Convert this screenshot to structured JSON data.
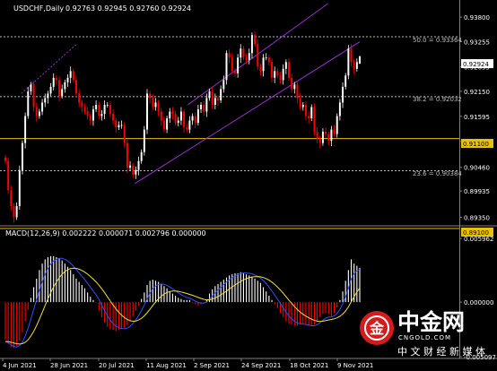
{
  "symbol_label": "USDCHF,Daily",
  "ohlc_label": "0.92763 0.92945 0.92760 0.92924",
  "macd_label": "MACD(12,26,9) 0.002222 0.000071 0.002796 0.000000",
  "fib_labels": [
    "50.0 = 0.93364",
    "38.2 = 0.92032",
    "23.6 = 0.90384"
  ],
  "price_ticks": [
    "0.93800",
    "0.93255",
    "0.92695",
    "0.92150",
    "0.91595",
    "0.91035",
    "0.90460",
    "0.89935",
    "0.89350"
  ],
  "macd_ticks": [
    "0.005962",
    "0.000000",
    "-0.005097"
  ],
  "x_ticks": [
    "4 Jun 2021",
    "28 Jun 2021",
    "20 Jul 2021",
    "11 Aug 2021",
    "2 Sep 2021",
    "24 Sep 2021",
    "18 Oct 2021",
    "9 Nov 2021"
  ],
  "price_badges": {
    "current": "0.92924",
    "line_upper": "0.91100",
    "line_lower": "0.89100"
  },
  "watermark": {
    "logo_char": "金",
    "brand": "中金网",
    "url": "CNGOLD.COM",
    "slogan": "中 文 财 经 新 媒 体"
  },
  "colors": {
    "background": "#000000",
    "bull": "#ffffff",
    "bear": "#ff0000",
    "channel": "#9a30d0",
    "level": "#e6c200",
    "fib": "#bcbcbc",
    "macd_signal": "#f0e040",
    "macd_main": "#3050ff",
    "text": "#ffffff"
  },
  "chart_data": {
    "type": "candlestick",
    "symbol": "USDCHF",
    "timeframe": "Daily",
    "x_range": [
      "2021-05-31",
      "2021-11-19"
    ],
    "price_range": [
      0.892,
      0.941
    ],
    "last": {
      "open": 0.92763,
      "high": 0.92945,
      "low": 0.9276,
      "close": 0.92924
    },
    "closes": [
      0.906,
      0.8995,
      0.896,
      0.8935,
      0.896,
      0.904,
      0.91,
      0.916,
      0.9215,
      0.923,
      0.918,
      0.916,
      0.917,
      0.919,
      0.92,
      0.921,
      0.9225,
      0.9245,
      0.924,
      0.9205,
      0.922,
      0.9235,
      0.9245,
      0.926,
      0.924,
      0.921,
      0.919,
      0.918,
      0.917,
      0.916,
      0.915,
      0.9175,
      0.9185,
      0.916,
      0.9165,
      0.9185,
      0.9185,
      0.9165,
      0.915,
      0.9135,
      0.914,
      0.914,
      0.91,
      0.9045,
      0.905,
      0.903,
      0.904,
      0.906,
      0.908,
      0.913,
      0.921,
      0.92,
      0.918,
      0.919,
      0.917,
      0.915,
      0.913,
      0.9155,
      0.917,
      0.9165,
      0.9145,
      0.915,
      0.917,
      0.9135,
      0.913,
      0.915,
      0.916,
      0.9145,
      0.9175,
      0.9185,
      0.917,
      0.92,
      0.9215,
      0.9185,
      0.92,
      0.9195,
      0.922,
      0.924,
      0.93,
      0.929,
      0.926,
      0.9255,
      0.929,
      0.931,
      0.929,
      0.9285,
      0.93,
      0.934,
      0.932,
      0.927,
      0.926,
      0.929,
      0.929,
      0.928,
      0.9245,
      0.926,
      0.925,
      0.924,
      0.9265,
      0.928,
      0.9245,
      0.922,
      0.923,
      0.92,
      0.918,
      0.9185,
      0.916,
      0.9155,
      0.918,
      0.9125,
      0.911,
      0.91,
      0.9125,
      0.912,
      0.9105,
      0.913,
      0.912,
      0.916,
      0.919,
      0.9225,
      0.925,
      0.931,
      0.928,
      0.9265,
      0.928,
      0.92924
    ],
    "horizontal_levels": [
      {
        "price": 0.93364,
        "label": "50.0 = 0.93364",
        "kind": "fibonacci"
      },
      {
        "price": 0.92032,
        "label": "38.2 = 0.92032",
        "kind": "fibonacci"
      },
      {
        "price": 0.90384,
        "label": "23.6 = 0.90384",
        "kind": "fibonacci"
      },
      {
        "price": 0.911,
        "kind": "support"
      },
      {
        "price": 0.891,
        "kind": "support"
      }
    ],
    "trend_lines": [
      {
        "points": [
          [
            "2021-06-07",
            0.921
          ],
          [
            "2021-06-28",
            0.932
          ]
        ],
        "style": "dotted"
      },
      {
        "points": [
          [
            "2021-08-09",
            0.9185
          ],
          [
            "2021-10-01",
            0.941
          ]
        ],
        "style": "solid"
      },
      {
        "points": [
          [
            "2021-07-20",
            0.901
          ],
          [
            "2021-10-13",
            0.9325
          ]
        ],
        "style": "solid"
      }
    ],
    "macd": {
      "params": [
        12,
        26,
        9
      ],
      "values": [
        0.002222,
        7.1e-05,
        0.002796,
        0.0
      ],
      "y_range": [
        -0.005097,
        0.005962
      ],
      "histogram": [
        -0.0035,
        -0.0039,
        -0.0042,
        -0.0043,
        -0.0041,
        -0.0036,
        -0.0028,
        -0.0018,
        -0.0007,
        0.0004,
        0.0014,
        0.0022,
        0.003,
        0.0036,
        0.004,
        0.0042,
        0.0043,
        0.0043,
        0.0042,
        0.0041,
        0.0039,
        0.0036,
        0.0033,
        0.003,
        0.0026,
        0.0022,
        0.0019,
        0.0016,
        0.0013,
        0.0009,
        0.0005,
        0.0002,
        -0.0001,
        -0.0008,
        -0.0014,
        -0.0019,
        -0.0023,
        -0.0025,
        -0.0026,
        -0.0027,
        -0.0026,
        -0.0025,
        -0.0024,
        -0.0022,
        -0.0018,
        -0.0013,
        -0.0008,
        -0.0003,
        0.0003,
        0.0009,
        0.0016,
        0.002,
        0.0021,
        0.002,
        0.0019,
        0.0017,
        0.0015,
        0.0013,
        0.001,
        0.0008,
        0.0006,
        0.0004,
        0.0003,
        0.0002,
        0.0002,
        0.0002,
        -0.0001,
        -0.0002,
        -0.0003,
        -0.0002,
        -0.0001,
        0.0002,
        0.0008,
        0.0012,
        0.0015,
        0.0017,
        0.0019,
        0.0021,
        0.0023,
        0.0025,
        0.0026,
        0.0027,
        0.0027,
        0.0028,
        0.0027,
        0.0026,
        0.0025,
        0.0024,
        0.0022,
        0.002,
        0.0018,
        0.0014,
        0.001,
        0.0006,
        0.0002,
        -0.0002,
        -0.0006,
        -0.001,
        -0.0014,
        -0.0018,
        -0.002,
        -0.0021,
        -0.0022,
        -0.0022,
        -0.0021,
        -0.002,
        -0.0021,
        -0.0022,
        -0.0022,
        -0.0021,
        -0.0018,
        -0.0014,
        -0.0011,
        -0.001,
        -0.0011,
        -0.0013,
        -0.001,
        -0.0005,
        0.0002,
        0.001,
        0.002,
        0.003,
        0.004,
        0.0036,
        0.0034,
        0.0032
      ]
    }
  }
}
